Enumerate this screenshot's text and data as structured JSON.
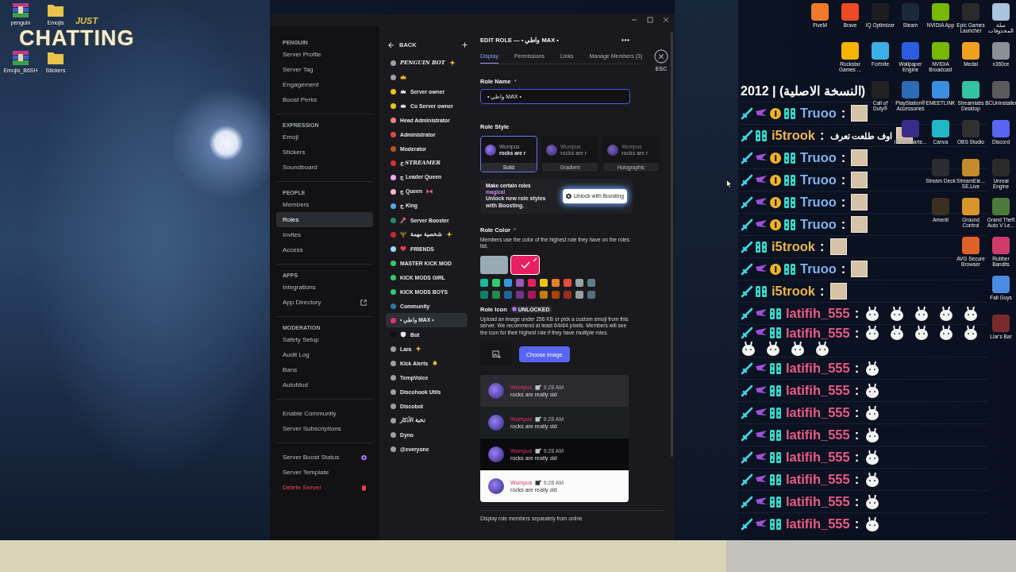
{
  "desktop_left": {
    "items": [
      {
        "label": "penguin",
        "kind": "archive"
      },
      {
        "label": "Emojis",
        "kind": "folder"
      },
      {
        "label": "Emojis_B6SH",
        "kind": "archive"
      },
      {
        "label": "Stickers",
        "kind": "folder"
      }
    ],
    "overlay_small": "JUST",
    "overlay_big": "CHATTING"
  },
  "window": {
    "sidebar": {
      "sections": [
        {
          "header": "PENGUIN",
          "items": [
            {
              "label": "Server Profile",
              "kind": "plain",
              "selected": false
            },
            {
              "label": "Server Tag",
              "kind": "plain",
              "selected": false
            },
            {
              "label": "Engagement",
              "kind": "plain",
              "selected": false
            },
            {
              "label": "Boost Perks",
              "kind": "plain",
              "selected": false
            }
          ]
        },
        {
          "header": "EXPRESSION",
          "items": [
            {
              "label": "Emoji",
              "kind": "plain",
              "selected": false
            },
            {
              "label": "Stickers",
              "kind": "plain",
              "selected": false
            },
            {
              "label": "Soundboard",
              "kind": "plain",
              "selected": false
            }
          ]
        },
        {
          "header": "PEOPLE",
          "items": [
            {
              "label": "Members",
              "kind": "plain",
              "selected": false
            },
            {
              "label": "Roles",
              "kind": "plain",
              "selected": true
            },
            {
              "label": "Invites",
              "kind": "plain",
              "selected": false
            },
            {
              "label": "Access",
              "kind": "plain",
              "selected": false
            }
          ]
        },
        {
          "header": "APPS",
          "items": [
            {
              "label": "Integrations",
              "kind": "plain",
              "selected": false
            },
            {
              "label": "App Directory",
              "kind": "link",
              "selected": false
            }
          ]
        },
        {
          "header": "MODERATION",
          "items": [
            {
              "label": "Safety Setup",
              "kind": "plain",
              "selected": false
            },
            {
              "label": "Audit Log",
              "kind": "plain",
              "selected": false
            },
            {
              "label": "Bans",
              "kind": "plain",
              "selected": false
            },
            {
              "label": "AutoMod",
              "kind": "plain",
              "selected": false
            }
          ]
        },
        {
          "items": [
            {
              "label": "Enable Community",
              "kind": "plain",
              "selected": false
            },
            {
              "label": "Server Subscriptions",
              "kind": "plain",
              "selected": false
            }
          ]
        },
        {
          "items": [
            {
              "label": "Server Boost Status",
              "kind": "boost",
              "selected": false
            },
            {
              "label": "Server Template",
              "kind": "plain",
              "selected": false
            },
            {
              "label": "Delete Server",
              "kind": "danger",
              "selected": false
            }
          ]
        }
      ]
    },
    "roles": {
      "back": "BACK",
      "items": [
        {
          "name": "PENGUIN BOT",
          "kind": "fancy",
          "color": "#9ba0a6",
          "icons_after": [
            {
              "kind": "sparkle"
            }
          ],
          "selected": false
        },
        {
          "kind": "plain",
          "color": "#9ba0a6",
          "icons_before": [
            {
              "kind": "crown"
            }
          ],
          "selected": false
        },
        {
          "name": "Server owner",
          "kind": "plain",
          "color": "#f1c40f",
          "icons_before": [
            {
              "kind": "queen"
            }
          ],
          "selected": false
        },
        {
          "name": "Co Server owner",
          "kind": "plain",
          "color": "#f1c40f",
          "icons_before": [
            {
              "kind": "queen"
            }
          ],
          "selected": false
        },
        {
          "name": "Head Administrator",
          "kind": "plain",
          "color": "#f27d8c",
          "selected": false
        },
        {
          "name": "Administrator",
          "kind": "plain",
          "color": "#e04848",
          "selected": false
        },
        {
          "name": "Moderator",
          "kind": "plain",
          "color": "#b4581e",
          "selected": false
        },
        {
          "name": "ج STREAMER",
          "kind": "fancy",
          "color": "#e02b3a",
          "selected": false
        },
        {
          "name": "ج Leader Queen",
          "kind": "plain",
          "color": "#f0a8ee",
          "selected": false
        },
        {
          "name": "ج Queen",
          "kind": "plain",
          "color": "#f5b5c8",
          "icons_after": [
            {
              "kind": "bow"
            }
          ],
          "selected": false
        },
        {
          "name": "ج King",
          "kind": "plain",
          "color": "#5aa3e0",
          "selected": false
        },
        {
          "name": "Server Booster",
          "kind": "plain",
          "color": "#1f8b6e",
          "icons_before": [
            {
              "kind": "pin"
            }
          ],
          "selected": false
        },
        {
          "name": "شخصية مهمة",
          "kind": "plain",
          "color": "#d3203a",
          "icons_before": [
            {
              "kind": "trident"
            }
          ],
          "icons_after": [
            {
              "kind": "sparkle"
            }
          ],
          "selected": false
        },
        {
          "name": "FRIENDS",
          "kind": "plain",
          "color": "#9dd4f5",
          "icons_before": [
            {
              "kind": "heart"
            }
          ],
          "selected": false
        },
        {
          "name": "MASTER KICK MOD",
          "kind": "plain",
          "color": "#2ecc71",
          "selected": false
        },
        {
          "name": "KICK MODS GIRL",
          "kind": "plain",
          "color": "#2ecc71",
          "selected": false
        },
        {
          "name": "KICK MODS BOYS",
          "kind": "plain",
          "color": "#2ecc71",
          "selected": false
        },
        {
          "name": "Community",
          "kind": "plain",
          "color": "#2a7aa0",
          "selected": false
        },
        {
          "name": "• واطي MAX •",
          "kind": "plain",
          "color": "#e0336e",
          "selected": true
        },
        {
          "name": "Bot",
          "kind": "plain",
          "color": "#111111",
          "icons_before": [
            {
              "kind": "shield"
            }
          ],
          "selected": false
        },
        {
          "name": "Lara",
          "kind": "plain",
          "color": "#9ba0a6",
          "icons_after": [
            {
              "kind": "sparkle"
            }
          ],
          "selected": false
        },
        {
          "name": "Kick Alerts",
          "kind": "plain",
          "color": "#9ba0a6",
          "icons_after": [
            {
              "kind": "bell"
            }
          ],
          "selected": false
        },
        {
          "name": "TempVoice",
          "kind": "plain",
          "color": "#9ba0a6",
          "selected": false
        },
        {
          "name": "Discohook Utils",
          "kind": "plain",
          "color": "#9ba0a6",
          "selected": false
        },
        {
          "name": "Discobot",
          "kind": "plain",
          "color": "#9ba0a6",
          "selected": false
        },
        {
          "name": "نخبة الأذكار",
          "kind": "plain",
          "color": "#9ba0a6",
          "selected": false
        },
        {
          "name": "Dyno",
          "kind": "plain",
          "color": "#9ba0a6",
          "selected": false
        },
        {
          "name": "@everyone",
          "kind": "plain",
          "color": "#9ba0a6",
          "selected": false
        }
      ]
    },
    "editor": {
      "title": "EDIT ROLE — • واطي MAX •",
      "close_label": "ESC",
      "tabs": [
        {
          "label": "Display",
          "selected": true
        },
        {
          "label": "Permissions",
          "selected": false
        },
        {
          "label": "Links",
          "selected": false
        },
        {
          "label": "Manage Members (3)",
          "selected": false
        }
      ],
      "role_name": {
        "label": "Role Name",
        "required": "*",
        "value": "• واطي MAX •"
      },
      "role_style": {
        "label": "Role Style",
        "options": [
          {
            "label": "Solid",
            "author": "Wumpus",
            "text": "rocks are r",
            "selected": true,
            "locked": false
          },
          {
            "label": "Gradient",
            "author": "Wumpus",
            "text": "rocks are r",
            "selected": false,
            "locked": true
          },
          {
            "label": "Holographic",
            "author": "Wumpus",
            "text": "rocks are r",
            "selected": false,
            "locked": true
          }
        ]
      },
      "promo": {
        "title": "Make certain roles",
        "highlight": "magical",
        "text": "Unlock new role styles with Boosting.",
        "button": "Unlock with Boosting"
      },
      "role_color": {
        "label": "Role Color",
        "required": "*",
        "description": "Members use the color of the highest role they have on the roles list.",
        "default": {
          "color": "#99aab5",
          "selected": false
        },
        "custom": {
          "color": "#e91e63",
          "selected": true
        },
        "swatches": [
          {
            "color": "#1abc9c",
            "selected": false
          },
          {
            "color": "#2ecc71",
            "selected": false
          },
          {
            "color": "#3498db",
            "selected": false
          },
          {
            "color": "#9b59b6",
            "selected": false
          },
          {
            "color": "#e91e63",
            "selected": false
          },
          {
            "color": "#f1c40f",
            "selected": false
          },
          {
            "color": "#e67e22",
            "selected": false
          },
          {
            "color": "#e74c3c",
            "selected": false
          },
          {
            "color": "#95a5a6",
            "selected": false
          },
          {
            "color": "#607d8b",
            "selected": false
          },
          {
            "color": "#11806a",
            "selected": false
          },
          {
            "color": "#1f8b4c",
            "selected": false
          },
          {
            "color": "#206694",
            "selected": false
          },
          {
            "color": "#71368a",
            "selected": false
          },
          {
            "color": "#ad1457",
            "selected": false
          },
          {
            "color": "#c27c0e",
            "selected": false
          },
          {
            "color": "#a84300",
            "selected": false
          },
          {
            "color": "#992d22",
            "selected": false
          },
          {
            "color": "#979c9f",
            "selected": false
          },
          {
            "color": "#546e7a",
            "selected": false
          }
        ]
      },
      "role_icon": {
        "label": "Role Icon",
        "badge": "UNLOCKED",
        "description": "Upload an image under 256 KB or pick a custom emoji from this server. We recommend at least 64x64 pixels. Members will see the icon for their highest role if they have multiple roles.",
        "button": "Choose Image"
      },
      "previews": [
        {
          "kind": "dim",
          "author": "Wumpus",
          "time": "9:28 AM",
          "text": "rocks are really old"
        },
        {
          "kind": "dark",
          "author": "Wumpus",
          "time": "9:28 AM",
          "text": "rocks are really old"
        },
        {
          "kind": "black",
          "author": "Wumpus",
          "time": "9:28 AM",
          "text": "rocks are really old"
        },
        {
          "kind": "light",
          "author": "Wumpus",
          "time": "9:28 AM",
          "text": "rocks are really old"
        }
      ],
      "footer_text": "Display role members separately from online"
    }
  },
  "chat": {
    "header": "2012 | (النسخة الاصلية)",
    "messages": [
      {
        "badges": [
          {
            "kind": "sword"
          },
          {
            "kind": "wing"
          },
          {
            "kind": "coin"
          },
          {
            "kind": "grid"
          }
        ],
        "user": "Truoo",
        "color": "#7fb2ea",
        "sep": ":",
        "emotes": [
          {
            "kind": "photo"
          }
        ]
      },
      {
        "badges": [
          {
            "kind": "sword"
          },
          {
            "kind": "grid"
          }
        ],
        "user": "i5trook",
        "color": "#eab54a",
        "sep": ":",
        "text": "اوف طلعت تعرف",
        "emotes": [
          {
            "kind": "photo"
          }
        ]
      },
      {
        "badges": [
          {
            "kind": "sword"
          },
          {
            "kind": "wing"
          },
          {
            "kind": "coin"
          },
          {
            "kind": "grid"
          }
        ],
        "user": "Truoo",
        "color": "#7fb2ea",
        "sep": ":",
        "emotes": [
          {
            "kind": "photo"
          }
        ]
      },
      {
        "badges": [
          {
            "kind": "sword"
          },
          {
            "kind": "wing"
          },
          {
            "kind": "coin"
          },
          {
            "kind": "grid"
          }
        ],
        "user": "Truoo",
        "color": "#7fb2ea",
        "sep": ":",
        "emotes": [
          {
            "kind": "photo"
          }
        ]
      },
      {
        "badges": [
          {
            "kind": "sword"
          },
          {
            "kind": "wing"
          },
          {
            "kind": "coin"
          },
          {
            "kind": "grid"
          }
        ],
        "user": "Truoo",
        "color": "#7fb2ea",
        "sep": ":",
        "emotes": [
          {
            "kind": "photo"
          }
        ]
      },
      {
        "badges": [
          {
            "kind": "sword"
          },
          {
            "kind": "wing"
          },
          {
            "kind": "coin"
          },
          {
            "kind": "grid"
          }
        ],
        "user": "Truoo",
        "color": "#7fb2ea",
        "sep": ":",
        "emotes": [
          {
            "kind": "photo"
          }
        ]
      },
      {
        "badges": [
          {
            "kind": "sword"
          },
          {
            "kind": "grid"
          }
        ],
        "user": "i5trook",
        "color": "#eab54a",
        "sep": ":",
        "emotes": [
          {
            "kind": "photo"
          }
        ]
      },
      {
        "badges": [
          {
            "kind": "sword"
          },
          {
            "kind": "wing"
          },
          {
            "kind": "coin"
          },
          {
            "kind": "grid"
          }
        ],
        "user": "Truoo",
        "color": "#7fb2ea",
        "sep": ":",
        "emotes": [
          {
            "kind": "photo"
          }
        ]
      },
      {
        "badges": [
          {
            "kind": "sword"
          },
          {
            "kind": "grid"
          }
        ],
        "user": "i5trook",
        "color": "#eab54a",
        "sep": ":",
        "emotes": [
          {
            "kind": "photo"
          }
        ]
      },
      {
        "badges": [
          {
            "kind": "sword"
          },
          {
            "kind": "wing"
          },
          {
            "kind": "grid"
          }
        ],
        "user": "latifih_555",
        "color": "#ec5a86",
        "sep": ":",
        "emotes": [
          {
            "kind": "bunny"
          },
          {
            "kind": "bunny"
          },
          {
            "kind": "bunny"
          },
          {
            "kind": "bunny"
          },
          {
            "kind": "bunny"
          }
        ]
      },
      {
        "badges": [
          {
            "kind": "sword"
          },
          {
            "kind": "wing"
          },
          {
            "kind": "grid"
          }
        ],
        "user": "latifih_555",
        "color": "#ec5a86",
        "sep": ":",
        "emotes": [
          {
            "kind": "bunny"
          },
          {
            "kind": "bunny"
          },
          {
            "kind": "bunny"
          },
          {
            "kind": "bunny"
          },
          {
            "kind": "bunny"
          },
          {
            "kind": "bunny"
          },
          {
            "kind": "bunny"
          },
          {
            "kind": "bunny"
          },
          {
            "kind": "bunny"
          }
        ]
      },
      {
        "badges": [
          {
            "kind": "sword"
          },
          {
            "kind": "wing"
          },
          {
            "kind": "grid"
          }
        ],
        "user": "latifih_555",
        "color": "#ec5a86",
        "sep": ":",
        "emotes": [
          {
            "kind": "bunny"
          }
        ]
      },
      {
        "badges": [
          {
            "kind": "sword"
          },
          {
            "kind": "wing"
          },
          {
            "kind": "grid"
          }
        ],
        "user": "latifih_555",
        "color": "#ec5a86",
        "sep": ":",
        "emotes": [
          {
            "kind": "bunny"
          }
        ]
      },
      {
        "badges": [
          {
            "kind": "sword"
          },
          {
            "kind": "wing"
          },
          {
            "kind": "grid"
          }
        ],
        "user": "latifih_555",
        "color": "#ec5a86",
        "sep": ":",
        "emotes": [
          {
            "kind": "bunny"
          }
        ]
      },
      {
        "badges": [
          {
            "kind": "sword"
          },
          {
            "kind": "wing"
          },
          {
            "kind": "grid"
          }
        ],
        "user": "latifih_555",
        "color": "#ec5a86",
        "sep": ":",
        "emotes": [
          {
            "kind": "bunny"
          }
        ]
      },
      {
        "badges": [
          {
            "kind": "sword"
          },
          {
            "kind": "wing"
          },
          {
            "kind": "grid"
          }
        ],
        "user": "latifih_555",
        "color": "#ec5a86",
        "sep": ":",
        "emotes": [
          {
            "kind": "bunny"
          }
        ]
      },
      {
        "badges": [
          {
            "kind": "sword"
          },
          {
            "kind": "wing"
          },
          {
            "kind": "grid"
          }
        ],
        "user": "latifih_555",
        "color": "#ec5a86",
        "sep": ":",
        "emotes": [
          {
            "kind": "bunny"
          }
        ]
      },
      {
        "badges": [
          {
            "kind": "sword"
          },
          {
            "kind": "wing"
          },
          {
            "kind": "grid"
          }
        ],
        "user": "latifih_555",
        "color": "#ec5a86",
        "sep": ":",
        "emotes": [
          {
            "kind": "bunny"
          }
        ]
      },
      {
        "badges": [
          {
            "kind": "sword"
          },
          {
            "kind": "wing"
          },
          {
            "kind": "grid"
          }
        ],
        "user": "latifih_555",
        "color": "#ec5a86",
        "sep": ":",
        "emotes": [
          {
            "kind": "bunny"
          }
        ]
      }
    ]
  },
  "desktop_right": {
    "rows": [
      [
        {
          "label": "FiveM",
          "color": "#f07a2a"
        },
        {
          "label": "Brave",
          "color": "#f04a24"
        },
        {
          "label": "IQ Optimizer",
          "color": "#1c1c22"
        },
        {
          "label": "Steam",
          "color": "#1b2838"
        },
        {
          "label": "NVIDIA App",
          "color": "#76b900"
        },
        {
          "label": "Epic Games Launcher",
          "color": "#2a2a2a"
        },
        {
          "label": "سلة المحذوفات",
          "color": "#a9c4dc"
        }
      ],
      [
        "",
        {
          "label": "Rockstar Games ...",
          "color": "#f5b400"
        },
        {
          "label": "Fortnite",
          "color": "#3ab0e8"
        },
        {
          "label": "Wallpaper Engine",
          "color": "#2a5de0"
        },
        {
          "label": "NVIDIA Broadcast",
          "color": "#76b900"
        },
        {
          "label": "Medal",
          "color": "#f0a020"
        },
        {
          "label": "x360ce",
          "color": "#8a8f98"
        }
      ],
      [
        "",
        "",
        {
          "label": "Call of Duty®",
          "color": "#222222"
        },
        {
          "label": "PlayStation® Accessories",
          "color": "#2d6bb5"
        },
        {
          "label": "EMEETLINK",
          "color": "#3a8fe0"
        },
        {
          "label": "Streamlabs Desktop",
          "color": "#31c3a2"
        },
        {
          "label": "BCUninstaller",
          "color": "#5a5a5a"
        }
      ],
      [
        "",
        "",
        "",
        {
          "label": "IPTVSmarte...",
          "color": "#3a2d8a"
        },
        {
          "label": "Canva",
          "color": "#20b8c8"
        },
        {
          "label": "OBS Studio",
          "color": "#303030"
        },
        {
          "label": "Discord",
          "color": "#5865f2"
        }
      ],
      [
        "",
        "",
        "",
        "",
        {
          "label": "Stream Deck",
          "color": "#2b2b30"
        },
        {
          "label": "StreamEle... SE.Live",
          "color": "#c78a2a"
        },
        {
          "label": "Unreal Engine",
          "color": "#2a2a2a"
        }
      ],
      [
        "",
        "",
        "",
        "",
        {
          "label": "Amenti",
          "color": "#3a3020"
        },
        {
          "label": "Ground Control",
          "color": "#d8962a"
        },
        {
          "label": "Grand Theft Auto V Le...",
          "color": "#4b7a3a"
        }
      ],
      [
        "",
        "",
        "",
        "",
        "",
        {
          "label": "AVG Secure Browser",
          "color": "#e0602a"
        },
        {
          "label": "Rubber Bandits",
          "color": "#d03a6a"
        }
      ],
      [
        "",
        "",
        "",
        "",
        "",
        "",
        {
          "label": "Fall Guys",
          "color": "#4a8ae0"
        }
      ],
      [
        "",
        "",
        "",
        "",
        "",
        "",
        {
          "label": "Liar's Bar",
          "color": "#7a2a2a"
        }
      ]
    ]
  }
}
